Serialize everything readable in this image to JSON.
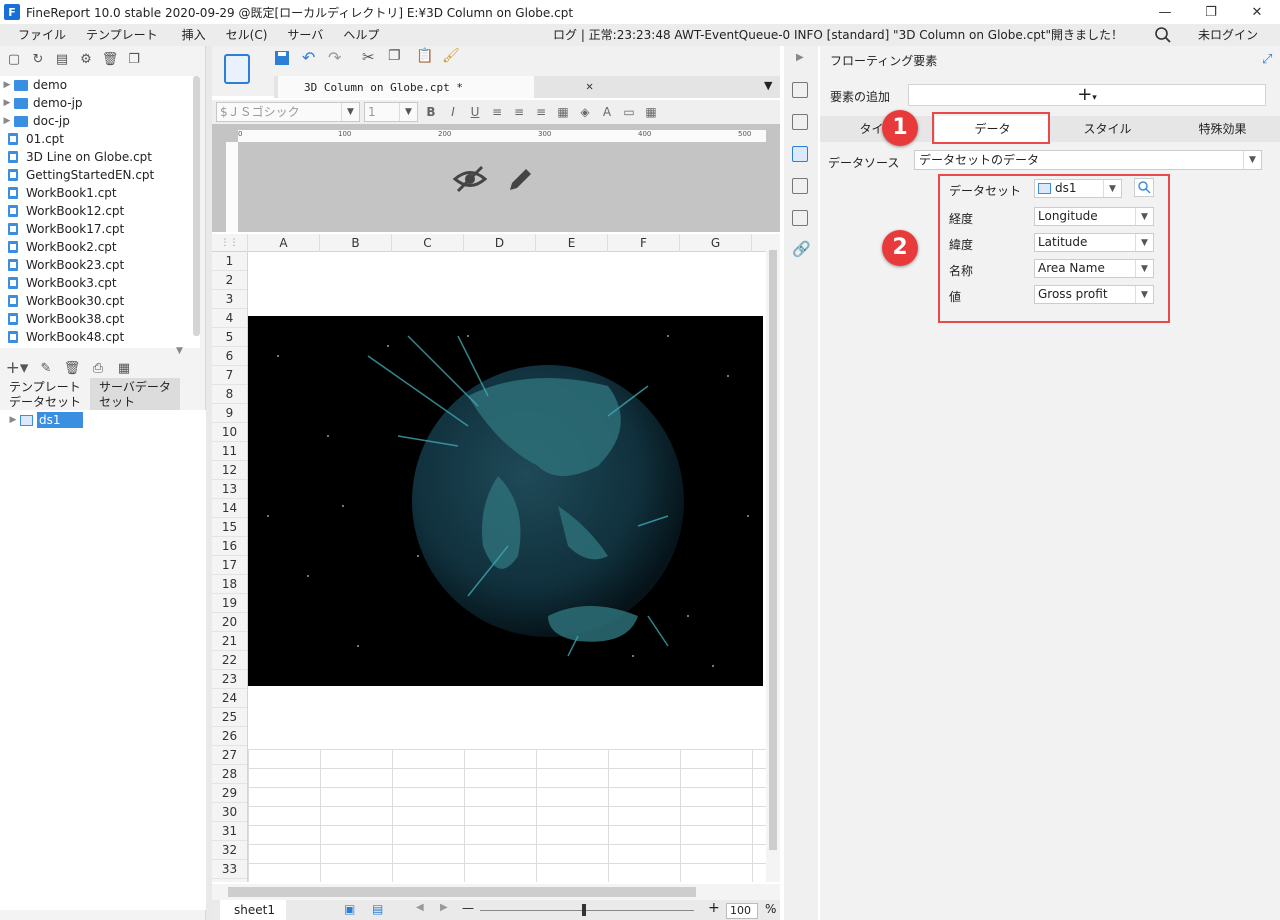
{
  "window": {
    "title": "FineReport 10.0 stable 2020-09-29 @既定[ローカルディレクトリ]   E:¥3D Column on Globe.cpt",
    "minimize": "—",
    "restore": "❐",
    "close": "✕"
  },
  "menu": {
    "items": [
      "ファイル",
      "テンプレート",
      "挿入",
      "セル(C)",
      "サーバ",
      "ヘルプ"
    ],
    "log": "ログ | 正常:23:23:48 AWT-EventQueue-0 INFO [standard] \"3D Column on Globe.cpt\"開きました！",
    "login": "未ログイン"
  },
  "file_tree": {
    "items": [
      {
        "label": "demo",
        "type": "folder"
      },
      {
        "label": "demo-jp",
        "type": "folder"
      },
      {
        "label": "doc-jp",
        "type": "folder"
      },
      {
        "label": "01.cpt",
        "type": "file"
      },
      {
        "label": "3D Line on Globe.cpt",
        "type": "file"
      },
      {
        "label": "GettingStartedEN.cpt",
        "type": "file"
      },
      {
        "label": "WorkBook1.cpt",
        "type": "file"
      },
      {
        "label": "WorkBook12.cpt",
        "type": "file"
      },
      {
        "label": "WorkBook17.cpt",
        "type": "file"
      },
      {
        "label": "WorkBook2.cpt",
        "type": "file"
      },
      {
        "label": "WorkBook23.cpt",
        "type": "file"
      },
      {
        "label": "WorkBook3.cpt",
        "type": "file"
      },
      {
        "label": "WorkBook30.cpt",
        "type": "file"
      },
      {
        "label": "WorkBook38.cpt",
        "type": "file"
      },
      {
        "label": "WorkBook48.cpt",
        "type": "file"
      }
    ]
  },
  "dataset_panel": {
    "tab_template": "テンプレート\nデータセット",
    "tab_server": "サーバデータ\nセット",
    "dataset": "ds1"
  },
  "editor": {
    "file_tab": "3D Column on Globe.cpt *",
    "font": "$ＪＳゴシック",
    "font_size": "1",
    "bold": "B",
    "italic": "I",
    "underline": "U",
    "ruler_marks": [
      "0",
      "100",
      "200",
      "300",
      "400",
      "500"
    ],
    "columns": [
      "A",
      "B",
      "C",
      "D",
      "E",
      "F",
      "G"
    ],
    "rows": [
      "1",
      "2",
      "3",
      "4",
      "5",
      "6",
      "7",
      "8",
      "9",
      "10",
      "11",
      "12",
      "13",
      "14",
      "15",
      "16",
      "17",
      "18",
      "19",
      "20",
      "21",
      "22",
      "23",
      "24",
      "25",
      "26",
      "27",
      "28",
      "29",
      "30",
      "31",
      "32",
      "33"
    ],
    "sheet_tab": "sheet1",
    "zoom": "100",
    "zoom_unit": "%",
    "zoom_minus": "—",
    "zoom_plus": "+"
  },
  "right_panel": {
    "title": "フローティング要素",
    "add_label": "要素の追加",
    "add_button": "+",
    "tabs": [
      "タイプ",
      "データ",
      "スタイル",
      "特殊効果"
    ],
    "data_source_label": "データソース",
    "data_source_value": "データセットのデータ",
    "mapping": {
      "dataset_label": "データセット",
      "dataset_value": "ds1",
      "longitude_label": "経度",
      "longitude_value": "Longitude",
      "latitude_label": "緯度",
      "latitude_value": "Latitude",
      "name_label": "名称",
      "name_value": "Area Name",
      "value_label": "値",
      "value_value": "Gross profit"
    },
    "badge1": "1",
    "badge2": "2"
  },
  "colors": {
    "accent": "#2d7fd6",
    "highlight_red": "#e84a4a",
    "selection": "#3b8fe0"
  }
}
